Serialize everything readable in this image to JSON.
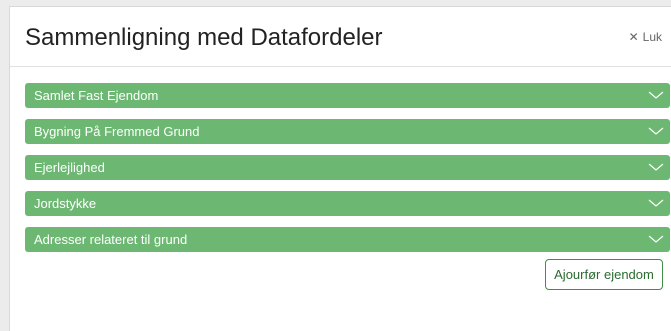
{
  "modal": {
    "title": "Sammenligning med Datafordeler",
    "close_icon": "close-icon",
    "close_label": "Luk"
  },
  "accordion": {
    "items": [
      {
        "label": "Samlet Fast Ejendom",
        "icon": "chevron-down-icon"
      },
      {
        "label": "Bygning På Fremmed Grund",
        "icon": "chevron-down-icon"
      },
      {
        "label": "Ejerlejlighed",
        "icon": "chevron-down-icon"
      },
      {
        "label": "Jordstykke",
        "icon": "chevron-down-icon"
      },
      {
        "label": "Adresser relateret til grund",
        "icon": "chevron-down-icon"
      }
    ],
    "color": "#6cb872"
  },
  "footer": {
    "update_button_label": "Ajourfør ejendom",
    "update_button_color": "#3f8f46"
  }
}
